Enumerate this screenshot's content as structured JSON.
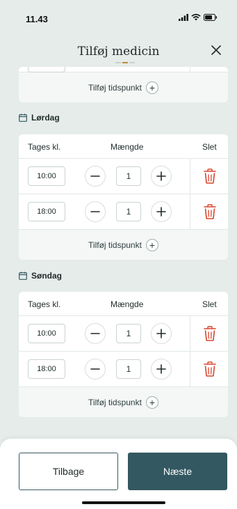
{
  "status": {
    "time": "11.43"
  },
  "header": {
    "title": "Tilføj medicin"
  },
  "table": {
    "col_time": "Tages kl.",
    "col_amount": "Mængde",
    "col_delete": "Slet",
    "add_time_label": "Tilføj tidspunkt"
  },
  "days": [
    {
      "name": "Lørdag",
      "rows": [
        {
          "time": "10:00",
          "quantity": "1"
        },
        {
          "time": "18:00",
          "quantity": "1"
        }
      ]
    },
    {
      "name": "Søndag",
      "rows": [
        {
          "time": "10:00",
          "quantity": "1"
        },
        {
          "time": "18:00",
          "quantity": "1"
        }
      ]
    }
  ],
  "footer": {
    "back_label": "Tilbage",
    "next_label": "Næste"
  },
  "colors": {
    "primary": "#345861",
    "delete": "#d9432b",
    "background": "#e5ece9"
  }
}
